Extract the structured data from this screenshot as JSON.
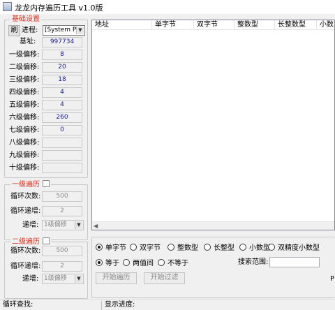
{
  "window": {
    "title": "龙龙内存遍历工具 v1.0版"
  },
  "basic": {
    "group_title": "基础设置",
    "refresh_label": "刷",
    "process_label": "进程:",
    "process_value": "[System Pro",
    "base_label": "基址:",
    "base_value": "997734",
    "offsets": [
      {
        "label": "一级偏移:",
        "value": "8"
      },
      {
        "label": "二级偏移:",
        "value": "20"
      },
      {
        "label": "三级偏移:",
        "value": "18"
      },
      {
        "label": "四级偏移:",
        "value": "4"
      },
      {
        "label": "五级偏移:",
        "value": "4"
      },
      {
        "label": "六级偏移:",
        "value": "260"
      },
      {
        "label": "七级偏移:",
        "value": "0"
      },
      {
        "label": "八级偏移:",
        "value": ""
      },
      {
        "label": "九级偏移:",
        "value": ""
      },
      {
        "label": "十级偏移:",
        "value": ""
      }
    ]
  },
  "level1": {
    "group_title": "一级遍历",
    "count_label": "循环次数:",
    "count_value": "500",
    "step_label": "循环递增:",
    "step_value": "2",
    "inc_label": "递增:",
    "inc_value": "1级偏移"
  },
  "level2": {
    "group_title": "二级遍历",
    "count_label": "循环次数:",
    "count_value": "500",
    "step_label": "循环递增:",
    "step_value": "2",
    "inc_label": "递增:",
    "inc_value": "1级偏移"
  },
  "results": {
    "columns": [
      "地址",
      "单字节",
      "双字节",
      "整数型",
      "长整数型",
      "小数"
    ]
  },
  "search": {
    "types": [
      {
        "label": "单字节",
        "selected": true
      },
      {
        "label": "双字节",
        "selected": false
      },
      {
        "label": "整数型",
        "selected": false
      },
      {
        "label": "长整型",
        "selected": false
      },
      {
        "label": "小数型",
        "selected": false
      },
      {
        "label": "双精度小数型",
        "selected": false
      }
    ],
    "compare": [
      {
        "label": "等于",
        "selected": true
      },
      {
        "label": "两值间",
        "selected": false
      },
      {
        "label": "不等于",
        "selected": false
      }
    ],
    "range_label": "搜索范围:",
    "range_value": "",
    "start_traverse": "开始遍历",
    "start_filter": "开始过滤",
    "cut_text": "P"
  },
  "status": {
    "loop_label": "循环查找:",
    "progress_label": "显示进度:"
  }
}
